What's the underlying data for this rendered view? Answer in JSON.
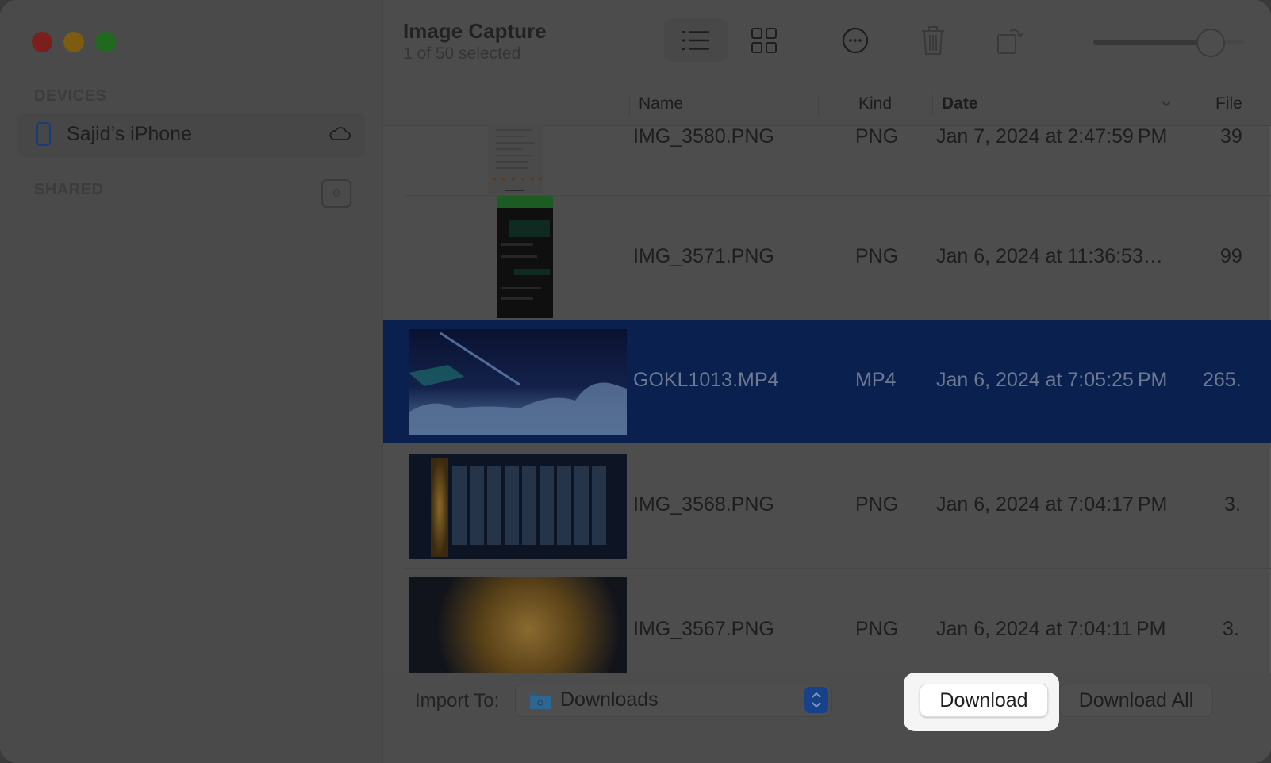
{
  "window": {
    "title": "Image Capture",
    "subtitle": "1 of 50 selected"
  },
  "sidebar": {
    "devices_label": "DEVICES",
    "device": {
      "name": "Sajid’s iPhone",
      "icon": "iphone-icon",
      "status_icon": "cloud-icon"
    },
    "shared_label": "SHARED",
    "shared_count": "0"
  },
  "toolbar": {
    "buttons": [
      {
        "name": "list-view",
        "icon": "list-icon",
        "active": true
      },
      {
        "name": "grid-view",
        "icon": "grid-icon",
        "active": false
      },
      {
        "name": "more",
        "icon": "ellipsis-circle-icon",
        "active": false
      },
      {
        "name": "delete",
        "icon": "trash-icon",
        "active": false
      },
      {
        "name": "rotate",
        "icon": "rotate-icon",
        "active": false
      }
    ],
    "thumbnail_size_fraction": 0.78
  },
  "table": {
    "columns": [
      {
        "label": "Name",
        "bold": false
      },
      {
        "label": "Kind",
        "bold": false
      },
      {
        "label": "Date",
        "bold": true,
        "sorted": "descending"
      },
      {
        "label": "File",
        "bold": false
      }
    ],
    "rows": [
      {
        "name": "IMG_3580.PNG",
        "kind": "PNG",
        "date": "Jan 7, 2024 at 2:47:59 PM",
        "size": "39",
        "selected": false,
        "thumb": "chat-screenshot-light"
      },
      {
        "name": "IMG_3571.PNG",
        "kind": "PNG",
        "date": "Jan 6, 2024 at 11:36:53…",
        "size": "99",
        "selected": false,
        "thumb": "chat-screenshot-dark"
      },
      {
        "name": "GOKL1013.MP4",
        "kind": "MP4",
        "date": "Jan 6, 2024 at 7:05:25 PM",
        "size": "265.",
        "selected": true,
        "thumb": "night-sky-video"
      },
      {
        "name": "IMG_3568.PNG",
        "kind": "PNG",
        "date": "Jan 6, 2024 at 7:04:17 PM",
        "size": "3.",
        "selected": false,
        "thumb": "game-weapons"
      },
      {
        "name": "IMG_3567.PNG",
        "kind": "PNG",
        "date": "Jan 6, 2024 at 7:04:11 PM",
        "size": "3.",
        "selected": false,
        "thumb": "game-character"
      }
    ]
  },
  "footer": {
    "import_label": "Import To:",
    "destination": "Downloads",
    "download_label": "Download",
    "download_all_label": "Download All"
  }
}
